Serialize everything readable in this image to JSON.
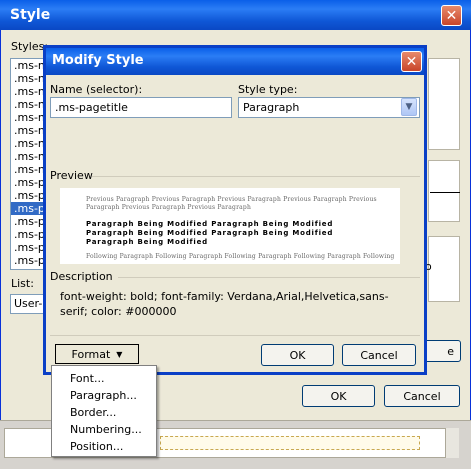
{
  "bg_window": {
    "title": "Style",
    "styles_label": "Styles:",
    "style_items": [
      ".ms-n",
      ".ms-n",
      ".ms-n",
      ".ms-n",
      ".ms-n",
      ".ms-n",
      ".ms-n",
      ".ms-n",
      ".ms-n",
      ".ms-p",
      ".ms-p",
      ".ms-p",
      ".ms-p",
      ".ms-p",
      ".ms-p",
      ".ms-p"
    ],
    "selected_index": 11,
    "list_label": "List:",
    "list_value": "User-",
    "side_letter_e": "e",
    "side_letter_o": "o",
    "ok_label": "OK",
    "cancel_label": "Cancel"
  },
  "dialog": {
    "title": "Modify Style",
    "name_label": "Name (selector):",
    "name_value": ".ms-pagetitle",
    "style_type_label": "Style type:",
    "style_type_value": "Paragraph",
    "preview_label": "Preview",
    "preview_previous": "Previous Paragraph Previous Paragraph Previous Paragraph Previous Paragraph Previous",
    "preview_previous2": "Paragraph Previous Paragraph Previous Paragraph",
    "preview_modified": [
      "Paragraph Being Modified Paragraph Being Modified",
      "Paragraph Being Modified Paragraph Being Modified",
      "Paragraph Being Modified"
    ],
    "preview_following": "Following Paragraph Following Paragraph Following Paragraph Following Paragraph Following Paragraph",
    "description_label": "Description",
    "description_text": "font-weight: bold; font-family: Verdana,Arial,Helvetica,sans-serif; color: #000000",
    "format_label": "Format",
    "ok_label": "OK",
    "cancel_label": "Cancel"
  },
  "format_menu": {
    "items": [
      "Font...",
      "Paragraph...",
      "Border...",
      "Numbering...",
      "Position..."
    ]
  }
}
